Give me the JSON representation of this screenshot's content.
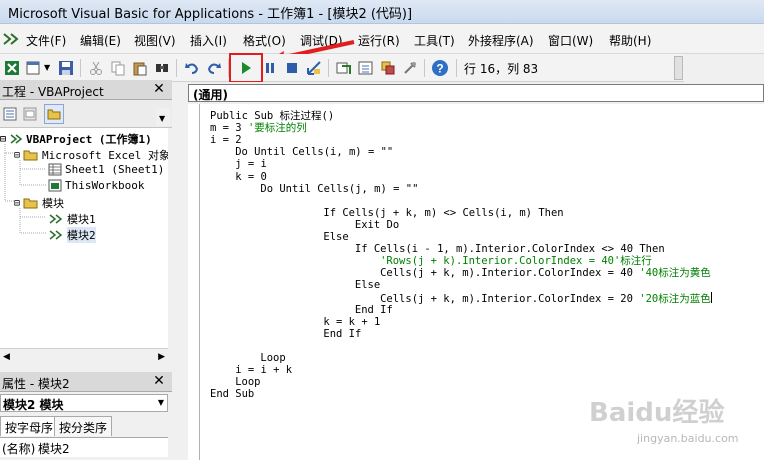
{
  "window": {
    "title": "Microsoft Visual Basic for Applications - 工作簿1 - [模块2 (代码)]"
  },
  "menu": [
    "文件(F)",
    "编辑(E)",
    "视图(V)",
    "插入(I)",
    "格式(O)",
    "调试(D)",
    "运行(R)",
    "工具(T)",
    "外接程序(A)",
    "窗口(W)",
    "帮助(H)"
  ],
  "toolbar": {
    "status": "行 16，列 83",
    "highlight_color": "#e21d1d"
  },
  "project_panel": {
    "title": "工程 - VBAProject",
    "tree": [
      {
        "label": "VBAProject (工作簿1)",
        "bold": true,
        "icon": "vba-project-icon"
      },
      {
        "label": "Microsoft Excel 对象",
        "icon": "folder-open-icon"
      },
      {
        "label": "Sheet1 (Sheet1)",
        "icon": "worksheet-icon"
      },
      {
        "label": "ThisWorkbook",
        "icon": "workbook-icon"
      },
      {
        "label": "模块",
        "icon": "folder-open-icon"
      },
      {
        "label": "模块1",
        "icon": "module-icon"
      },
      {
        "label": "模块2",
        "icon": "module-icon",
        "selected": true
      }
    ]
  },
  "properties_panel": {
    "title": "属性 - 模块2",
    "object": "模块2 模块",
    "tabs": [
      "按字母序",
      "按分类序"
    ],
    "row": {
      "name": "(名称)",
      "value": "模块2"
    }
  },
  "code_window": {
    "object_combo": "(通用)",
    "lines": [
      {
        "indent": 0,
        "text": "Public Sub 标注过程()"
      },
      {
        "indent": 0,
        "text": "m = 3 ",
        "comment": "'要标注的列"
      },
      {
        "indent": 0,
        "text": "i = 2"
      },
      {
        "indent": 4,
        "text": "Do Until Cells(i, m) = \"\""
      },
      {
        "indent": 4,
        "text": "j = i"
      },
      {
        "indent": 4,
        "text": "k = 0"
      },
      {
        "indent": 8,
        "text": "Do Until Cells(j, m) = \"\""
      },
      {
        "indent": 0,
        "text": ""
      },
      {
        "indent": 18,
        "text": "If Cells(j + k, m) <> Cells(i, m) Then"
      },
      {
        "indent": 23,
        "text": "Exit Do"
      },
      {
        "indent": 18,
        "text": "Else"
      },
      {
        "indent": 23,
        "text": "If Cells(i - 1, m).Interior.ColorIndex <> 40 Then"
      },
      {
        "indent": 27,
        "text": "",
        "comment": "'Rows(j + k).Interior.ColorIndex = 40'标注行"
      },
      {
        "indent": 27,
        "text": "Cells(j + k, m).Interior.ColorIndex = 40 ",
        "comment": "'40标注为黄色"
      },
      {
        "indent": 23,
        "text": "Else"
      },
      {
        "indent": 27,
        "text": "Cells(j + k, m).Interior.ColorIndex = 20 ",
        "comment": "'20标注为蓝色",
        "caret": true
      },
      {
        "indent": 23,
        "text": "End If"
      },
      {
        "indent": 18,
        "text": "k = k + 1"
      },
      {
        "indent": 18,
        "text": "End If"
      },
      {
        "indent": 0,
        "text": ""
      },
      {
        "indent": 8,
        "text": "Loop"
      },
      {
        "indent": 4,
        "text": "i = i + k"
      },
      {
        "indent": 4,
        "text": "Loop"
      },
      {
        "indent": 0,
        "text": "End Sub"
      }
    ],
    "comment_color": "#008000"
  },
  "watermark": {
    "text": "Baidu经验",
    "sub": "jingyan.baidu.com"
  }
}
